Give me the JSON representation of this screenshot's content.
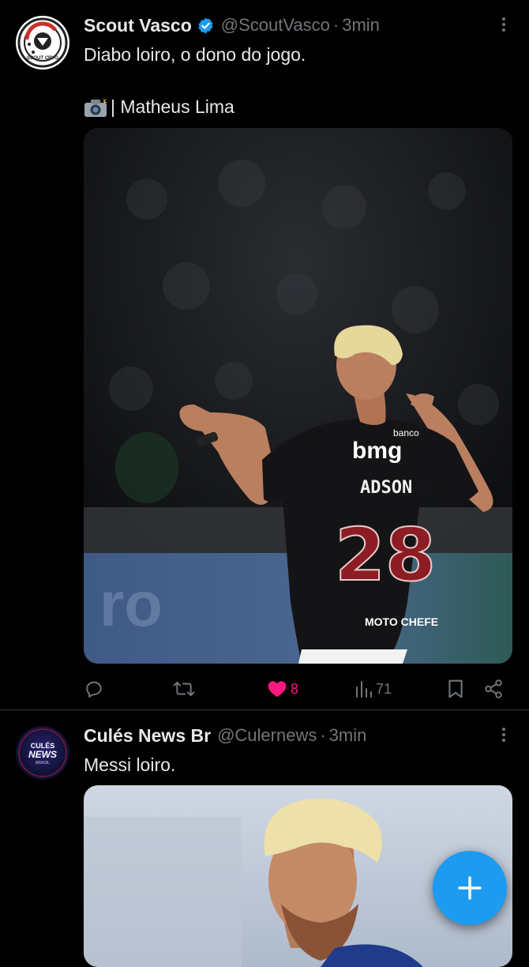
{
  "tweets": [
    {
      "display_name": "Scout Vasco",
      "handle": "@ScoutVasco",
      "separator": "·",
      "time": "3min",
      "line1": "Diabo loiro, o dono do jogo.",
      "line2": "| Matheus Lima",
      "avatar_text": "SCOUT CRVG",
      "jersey": {
        "sponsor_small": "banco",
        "sponsor": "bmg",
        "player_name": "ADSON",
        "number": "28",
        "brand": "MOTO CHEFE"
      },
      "stats": {
        "reply_count": "",
        "retweet_count": "",
        "like_count": "8",
        "view_count": "71"
      },
      "liked": true
    },
    {
      "display_name": "Culés News Br",
      "handle": "@Culernews",
      "separator": "·",
      "time": "3min",
      "line1": "Messi loiro.",
      "avatar_text": {
        "top": "CULÉS",
        "mid": "NEWS",
        "bottom": "BRASIL"
      }
    }
  ],
  "compose_button": {
    "icon": "plus-icon"
  },
  "colors": {
    "background": "#000000",
    "accent": "#1d9bf0",
    "like": "#f91880",
    "muted": "#71767b",
    "text": "#e7e9ea"
  }
}
